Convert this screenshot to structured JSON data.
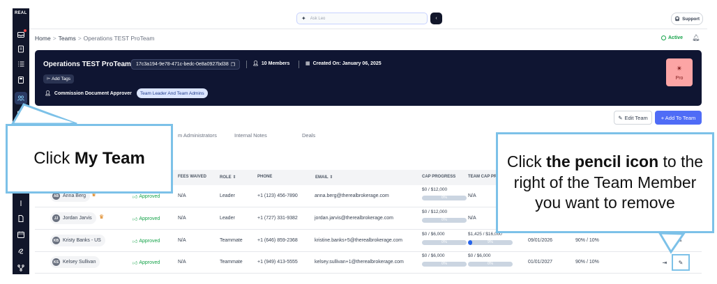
{
  "rail": {
    "logo": "REAL",
    "items": [
      "inbox",
      "clipboard",
      "list",
      "calculator",
      "my-team",
      "wallet",
      "more",
      "document",
      "calendar",
      "money",
      "network"
    ]
  },
  "topbar": {
    "ask_placeholder": "Ask Leo",
    "support_label": "Support"
  },
  "breadcrumb": {
    "items": [
      "Home",
      "Teams",
      "Operations TEST ProTeam"
    ],
    "separator": ">"
  },
  "status": {
    "label": "Active"
  },
  "banner": {
    "team_name": "Operations TEST ProTeam",
    "team_id": "17c3a194-9e78-471c-bedc-0e8a0927bd38",
    "members": "10 Members",
    "created": "Created On:  January 06, 2025",
    "add_tags": "Add Tags",
    "approver_label": "Commission Document Approver",
    "approver_value": "Team Leader And Team Admins",
    "plan": "Pro",
    "colors": {
      "background": "#0f1532",
      "plan_badge": "#fca5a5"
    }
  },
  "actions": {
    "edit_team": "Edit Team",
    "add_to_team": "+ Add To Team"
  },
  "tabs": [
    "m Administrators",
    "Internal Notes",
    "Deals"
  ],
  "table": {
    "headers": [
      "FEES WAIVED",
      "ROLE",
      "PHONE",
      "EMAIL",
      "CAP PROGRESS",
      "TEAM CAP PR"
    ],
    "rows": [
      {
        "initials": "AB",
        "name": "Anna Berg",
        "leader": true,
        "status": "Approved",
        "fees_waived": "N/A",
        "role": "Leader",
        "phone": "+1 (123) 456-7890",
        "email": "anna.berg@therealbrokerage.com",
        "cap": "$0 / $12,000",
        "cap_pct": "0%",
        "cap_fill": 0,
        "team_cap": "N/A",
        "team_cap_pct": "",
        "team_cap_fill": null,
        "date": "",
        "split": ""
      },
      {
        "initials": "JJ",
        "name": "Jordan Jarvis",
        "leader": true,
        "status": "Approved",
        "fees_waived": "N/A",
        "role": "Leader",
        "phone": "+1 (727) 331-9382",
        "email": "jordan.jarvis@therealbrokerage.com",
        "cap": "$0 / $12,000",
        "cap_pct": "0%",
        "cap_fill": 0,
        "team_cap": "N/A",
        "team_cap_pct": "",
        "team_cap_fill": null,
        "date": "",
        "split": ""
      },
      {
        "initials": "KB",
        "name": "Kristy Banks - US",
        "leader": false,
        "status": "Approved",
        "fees_waived": "N/A",
        "role": "Teammate",
        "phone": "+1 (646) 859-2368",
        "email": "kristine.banks+5@therealbrokerage.com",
        "cap": "$0 / $6,000",
        "cap_pct": "0%",
        "cap_fill": 0,
        "team_cap": "$1,425 / $16,000",
        "team_cap_pct": "9%",
        "team_cap_fill": 0.09,
        "date": "09/01/2026",
        "split": "90% / 10%"
      },
      {
        "initials": "KS",
        "name": "Kelsey Sullivan",
        "leader": false,
        "status": "Approved",
        "fees_waived": "N/A",
        "role": "Teammate",
        "phone": "+1 (949) 413-5555",
        "email": "kelsey.sullivan+1@therealbrokerage.com",
        "cap": "$0 / $6,000",
        "cap_pct": "0%",
        "cap_fill": 0,
        "team_cap": "$0 / $6,000",
        "team_cap_pct": "0%",
        "team_cap_fill": 0,
        "date": "01/01/2027",
        "split": "90% / 10%"
      }
    ]
  },
  "callouts": {
    "left_prefix": "Click ",
    "left_bold": "My Team",
    "right_prefix": "Click ",
    "right_bold": "the pencil icon",
    "right_suffix": " to the right of the Team Member you want to remove",
    "color": "#7cc1e8"
  }
}
